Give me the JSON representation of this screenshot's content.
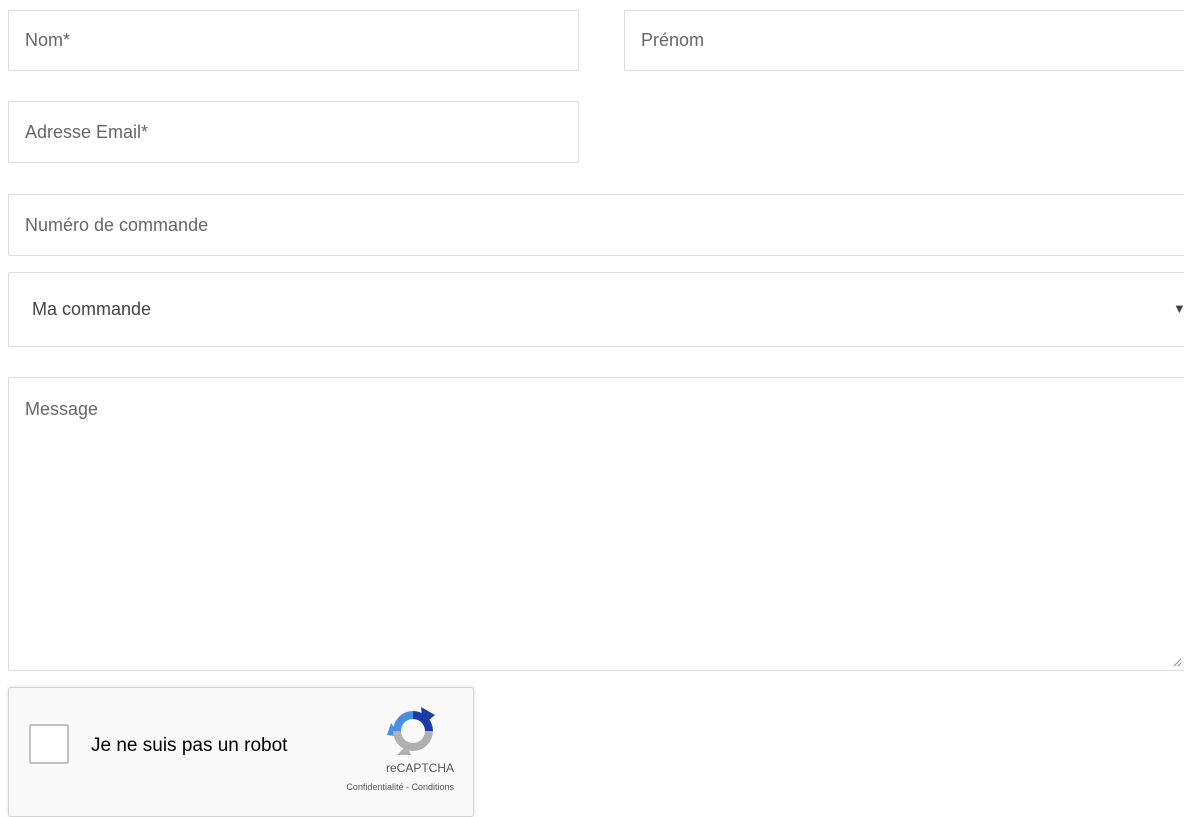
{
  "form": {
    "nom_placeholder": "Nom*",
    "prenom_placeholder": "Prénom",
    "email_placeholder": "Adresse Email*",
    "numero_placeholder": "Numéro de commande",
    "subject_select": {
      "selected": "Ma commande",
      "arrow_icon": "triangle-down-icon"
    },
    "message_placeholder": "Message"
  },
  "recaptcha": {
    "label": "Je ne suis pas un robot",
    "brand": "reCAPTCHA",
    "privacy_link": "Confidentialité",
    "separator": " - ",
    "terms_link": "Conditions",
    "logo_icon": "recaptcha-logo-icon",
    "colors": {
      "logo_blue": "#1c3aa9",
      "logo_light_blue": "#4a90e2",
      "logo_grey": "#b0b0b0"
    }
  }
}
